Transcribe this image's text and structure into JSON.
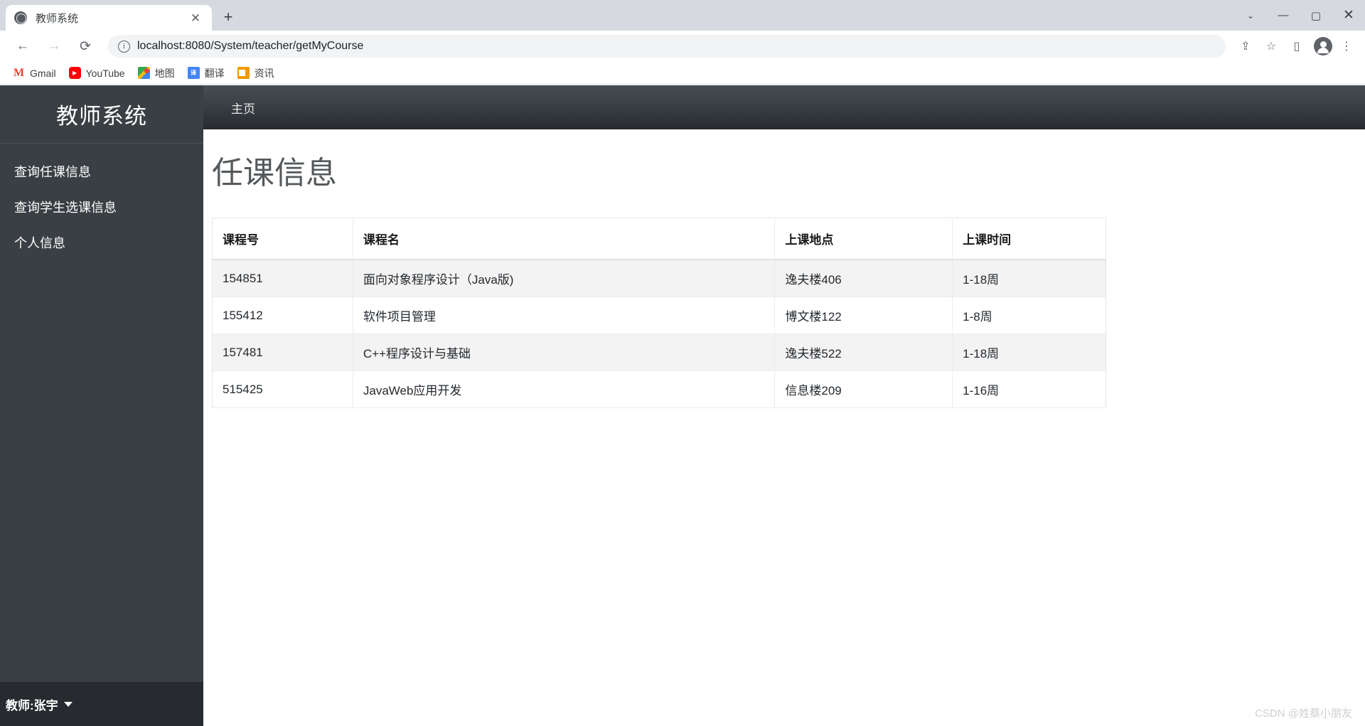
{
  "browser": {
    "tab": {
      "title": "教师系统",
      "favicon": "globe-icon",
      "close": "✕"
    },
    "new_tab": "+",
    "window_controls": {
      "chevron": "⌄",
      "minimize": "—",
      "maximize": "▢",
      "close": "✕"
    },
    "nav": {
      "back": "←",
      "forward": "→",
      "reload": "⟳"
    },
    "omnibox": {
      "info_icon": "ⓘ",
      "info_glyph": "i",
      "url": "localhost:8080/System/teacher/getMyCourse"
    },
    "toolbar_icons": {
      "share": "⇪",
      "bookmark": "☆",
      "sidepanel": "▯",
      "menu": "⋮"
    },
    "bookmarks": [
      {
        "label": "Gmail",
        "icon": "gmail-icon",
        "glyph": "M"
      },
      {
        "label": "YouTube",
        "icon": "youtube-icon",
        "glyph": "▶"
      },
      {
        "label": "地图",
        "icon": "google-maps-icon",
        "glyph": ""
      },
      {
        "label": "翻译",
        "icon": "google-translate-icon",
        "glyph": "译"
      },
      {
        "label": "资讯",
        "icon": "google-news-icon",
        "glyph": ""
      }
    ]
  },
  "sidebar": {
    "brand": "教师系统",
    "items": [
      {
        "label": "查询任课信息"
      },
      {
        "label": "查询学生选课信息"
      },
      {
        "label": "个人信息"
      }
    ],
    "footer": {
      "user": "教师:张宇"
    }
  },
  "navbar": {
    "home_link": "主页"
  },
  "main": {
    "title": "任课信息",
    "table": {
      "headers": [
        "课程号",
        "课程名",
        "上课地点",
        "上课时间"
      ],
      "rows": [
        [
          "154851",
          "面向对象程序设计（Java版)",
          "逸夫楼406",
          "1-18周"
        ],
        [
          "155412",
          "软件项目管理",
          "博文楼122",
          "1-8周"
        ],
        [
          "157481",
          "C++程序设计与基础",
          "逸夫楼522",
          "1-18周"
        ],
        [
          "515425",
          "JavaWeb应用开发",
          "信息楼209",
          "1-16周"
        ]
      ]
    }
  },
  "watermark": "CSDN @姓蔡小朋友"
}
